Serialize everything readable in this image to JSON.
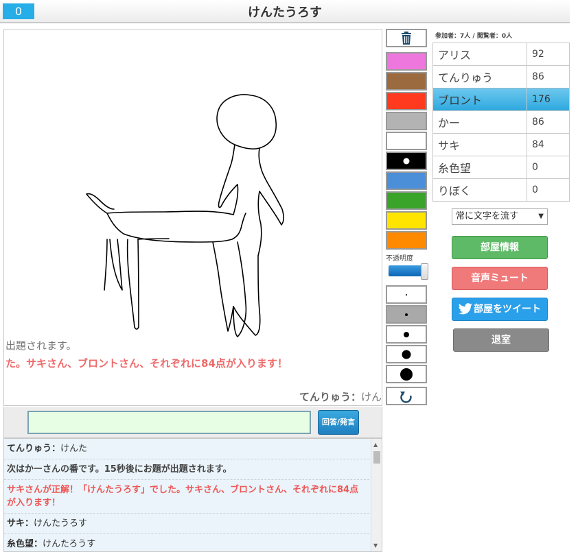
{
  "header": {
    "counter": "0",
    "title": "けんたうろす"
  },
  "canvas": {
    "flow_messages": {
      "line1": "出題されます。",
      "line2": "た。サキさん、ブロントさん、それぞれに84点が入ります！",
      "line3_name": "てんりゅう：",
      "line3_text": "けん"
    }
  },
  "input": {
    "value": "",
    "submit_label": "回答/発言"
  },
  "chat": [
    {
      "name": "てんりゅう：",
      "text": "けんた"
    },
    {
      "text": "次はかーさんの番です。15秒後にお題が出題されます。"
    },
    {
      "text": "サキさんが正解！「けんたうろす」でした。サキさん、ブロントさん、それぞれに84点が入ります！"
    },
    {
      "name": "サキ：",
      "text": "けんたうろす"
    },
    {
      "name": "糸色望：",
      "text": "けんたろうす"
    }
  ],
  "tools": {
    "trash_icon": "trash-icon",
    "colors": [
      "#ee77dd",
      "#9c6a3f",
      "#ff3a1f",
      "#b3b3b3",
      "#ffffff",
      "#000000",
      "#4b8fd9",
      "#3aa32a",
      "#ffe400",
      "#ff8a00"
    ],
    "opacity_label": "不透明度",
    "opacity_value": 1.0,
    "undo_icon": "undo-icon"
  },
  "participants_label": "参加者：7人 / 閲覧者：0人",
  "players": [
    {
      "name": "アリス",
      "score": "92"
    },
    {
      "name": "てんりゅう",
      "score": "86"
    },
    {
      "name": "ブロント",
      "score": "176",
      "active": true
    },
    {
      "name": "かー",
      "score": "86"
    },
    {
      "name": "サキ",
      "score": "84"
    },
    {
      "name": "糸色望",
      "score": "0"
    },
    {
      "name": "りぼく",
      "score": "0"
    }
  ],
  "flow_select": "常に文字を流す",
  "buttons": {
    "room_info": "部屋情報",
    "mute": "音声ミュート",
    "tweet": "部屋をツイート",
    "leave": "退室"
  }
}
